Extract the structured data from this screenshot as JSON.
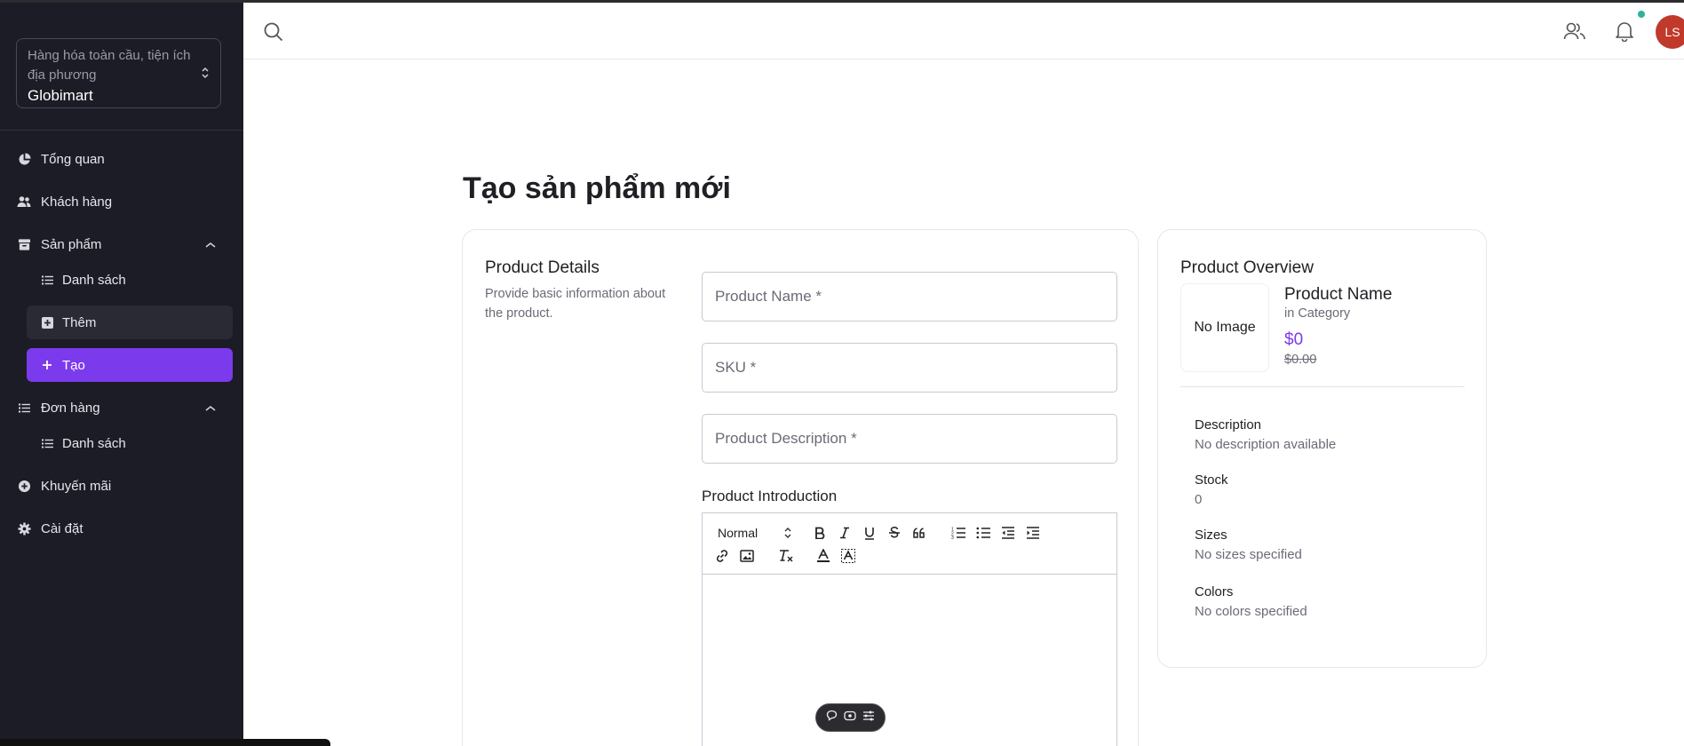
{
  "sidebar": {
    "org": {
      "description": "Hàng hóa toàn cầu, tiện ích địa phương",
      "name": "Globimart"
    },
    "nav": {
      "overview": "Tổng quan",
      "customers": "Khách hàng",
      "products": "Sản phẩm",
      "products_list": "Danh sách",
      "products_add": "Thêm",
      "products_create": "Tạo",
      "orders": "Đơn hàng",
      "orders_list": "Danh sách",
      "promotions": "Khuyến mãi",
      "settings": "Cài đặt"
    }
  },
  "header": {
    "avatar_initials": "LS",
    "notification_dot_color": "#2bb39a"
  },
  "page": {
    "title": "Tạo sản phẩm mới"
  },
  "details": {
    "title": "Product Details",
    "description": "Provide basic information about the product.",
    "name_placeholder": "Product Name *",
    "sku_placeholder": "SKU *",
    "description_placeholder": "Product Description *",
    "intro_label": "Product Introduction",
    "editor": {
      "format_select": "Normal"
    }
  },
  "overview": {
    "title": "Product Overview",
    "no_image": "No Image",
    "product_name": "Product Name",
    "category": "in Category",
    "price": "$0",
    "compare_price": "$0.00",
    "fields": {
      "description_label": "Description",
      "description_value": "No description available",
      "stock_label": "Stock",
      "stock_value": "0",
      "sizes_label": "Sizes",
      "sizes_value": "No sizes specified",
      "colors_label": "Colors",
      "colors_value": "No colors specified"
    }
  },
  "colors": {
    "accent": "#7c3aed",
    "sidebar_bg": "#1c1c26",
    "avatar_bg": "#c0392b"
  }
}
